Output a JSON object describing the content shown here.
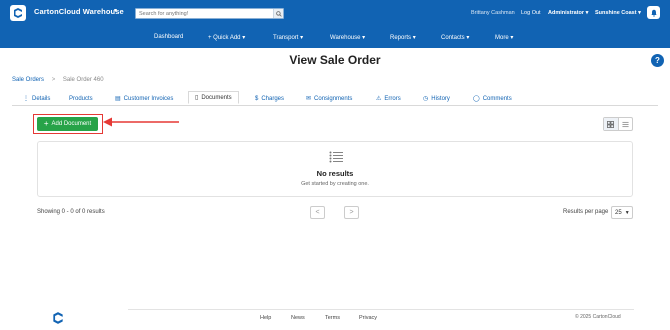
{
  "header": {
    "app_title": "CartonCloud Warehouse",
    "search_placeholder": "Search for anything!",
    "user_name": "Brittany Cashman",
    "logout": "Log Out",
    "role": "Administrator",
    "site": "Sunshine Coast",
    "brand_color": "#1163b3"
  },
  "nav": {
    "items": [
      "Dashboard",
      "+ Quick Add",
      "Transport",
      "Warehouse",
      "Reports",
      "Contacts",
      "More"
    ]
  },
  "page": {
    "title": "View Sale Order",
    "help": "?"
  },
  "breadcrumb": {
    "parent": "Sale Orders",
    "separator": ">",
    "current": "Sale Order 460"
  },
  "tabs": [
    {
      "label": "Details",
      "icon": "info-icon"
    },
    {
      "label": "Products",
      "icon": ""
    },
    {
      "label": "Customer Invoices",
      "icon": "invoice-icon"
    },
    {
      "label": "Documents",
      "icon": "document-icon",
      "active": true
    },
    {
      "label": "Charges",
      "icon": "dollar-icon"
    },
    {
      "label": "Consignments",
      "icon": "envelope-icon"
    },
    {
      "label": "Errors",
      "icon": "warning-icon"
    },
    {
      "label": "History",
      "icon": "clock-icon"
    },
    {
      "label": "Comments",
      "icon": "comment-icon"
    }
  ],
  "actions": {
    "add_document": "Add Document",
    "add_color": "#27a348",
    "highlight_color": "#e53935"
  },
  "empty_state": {
    "title": "No results",
    "subtitle": "Get started by creating one."
  },
  "pagination": {
    "showing": "Showing 0 - 0 of 0 results",
    "prev": "<",
    "next": ">",
    "rpp_label": "Results per page",
    "rpp_value": "25"
  },
  "footer": {
    "links": [
      "Help",
      "News",
      "Terms",
      "Privacy"
    ],
    "copyright": "© 2025 CartonCloud"
  }
}
